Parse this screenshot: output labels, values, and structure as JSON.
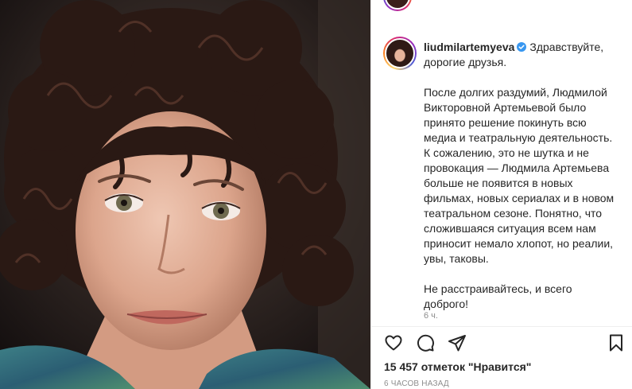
{
  "post": {
    "username": "liudmilartemyeva",
    "verified": true,
    "caption_paragraphs": [
      "Здравствуйте,\nдорогие друзья.",
      "После долгих раздумий, Людмилой\nВикторовной Артемьевой было\nпринято решение покинуть всю\nмедиа и театральную деятельность.\nК сожалению, это не шутка и не\nпровокация — Людмила Артемьева\nбольше не появится в новых\nфильмах, новых сериалах и в новом\nтеатральном сезоне. Понятно, что\nсложившаяся ситуация всем нам\nприносит немало хлопот, но реалии,\nувы, таковы.",
      "Не расстраивайтесь, и всего\nдоброго!"
    ],
    "caption_time": "6 ч.",
    "likes_text": "15 457 отметок \"Нравится\"",
    "posted_ago": "6 часов назад"
  },
  "icons": {
    "like": "heart-icon",
    "comment": "comment-icon",
    "share": "share-icon",
    "save": "bookmark-icon",
    "verified": "verified-badge-icon"
  },
  "colors": {
    "verified": "#3897f0",
    "text": "#262626",
    "muted": "#8e8e8e"
  }
}
